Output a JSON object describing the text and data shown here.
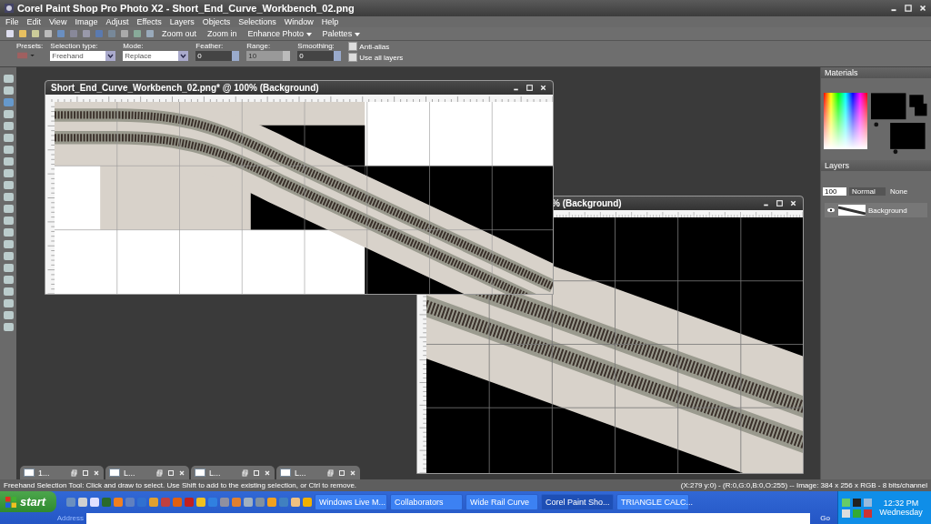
{
  "window": {
    "title": "Corel Paint Shop Pro Photo X2 - Short_End_Curve_Workbench_02.png"
  },
  "menu": [
    "File",
    "Edit",
    "View",
    "Image",
    "Adjust",
    "Effects",
    "Layers",
    "Objects",
    "Selections",
    "Window",
    "Help"
  ],
  "toolbar": {
    "buttons": [
      "Zoom out",
      "Zoom in"
    ],
    "menus": [
      "Enhance Photo",
      "Palettes"
    ]
  },
  "tool_options": {
    "presets_label": "Presets:",
    "fields": [
      {
        "label": "Selection type:",
        "value": "Freehand",
        "kind": "dropdown",
        "disabled": false
      },
      {
        "label": "Mode:",
        "value": "Replace",
        "kind": "dropdown",
        "disabled": false
      },
      {
        "label": "Feather:",
        "value": "0",
        "kind": "spinner",
        "disabled": false
      },
      {
        "label": "Range:",
        "value": "10",
        "kind": "spinner",
        "disabled": true
      },
      {
        "label": "Smoothing:",
        "value": "0",
        "kind": "spinner",
        "disabled": false
      }
    ],
    "checkboxes": [
      {
        "label": "Anti-alias",
        "checked": false
      },
      {
        "label": "Use all layers",
        "checked": false
      }
    ]
  },
  "documents": [
    {
      "title": "Short_End_Curve_Workbench_02.png* @ 100% (Background)",
      "kind": "light"
    },
    {
      "title": "% (Background)",
      "kind": "dark"
    }
  ],
  "minimized": [
    {
      "title": "1..."
    },
    {
      "title": "L..."
    },
    {
      "title": "L..."
    },
    {
      "title": "L..."
    }
  ],
  "palettes": {
    "materials": {
      "title": "Materials"
    },
    "layers": {
      "title": "Layers",
      "opacity": "100",
      "blend_mode": "Normal",
      "mask": "None",
      "items": [
        {
          "name": "Background"
        }
      ]
    }
  },
  "status_bar": {
    "hint": "Freehand Selection Tool: Click and draw to select. Use Shift to add to the existing selection, or Ctrl to remove.",
    "info": "(X:279 y:0) - (R:0,G:0,B:0,O:255) -- Image:  384 x 256 x RGB - 8 bits/channel"
  },
  "taskbar": {
    "start": "start",
    "tasks": [
      {
        "label": "Windows Live M...",
        "selected": false
      },
      {
        "label": "Collaborators",
        "selected": false
      },
      {
        "label": "Wide Rail Curve",
        "selected": false
      },
      {
        "label": "Corel Paint Sho...",
        "selected": true
      },
      {
        "label": "TRIANGLE CALC...",
        "selected": false
      }
    ],
    "address_label": "Address",
    "go": "Go",
    "clock": "12:32 PM",
    "day": "Wednesday"
  }
}
